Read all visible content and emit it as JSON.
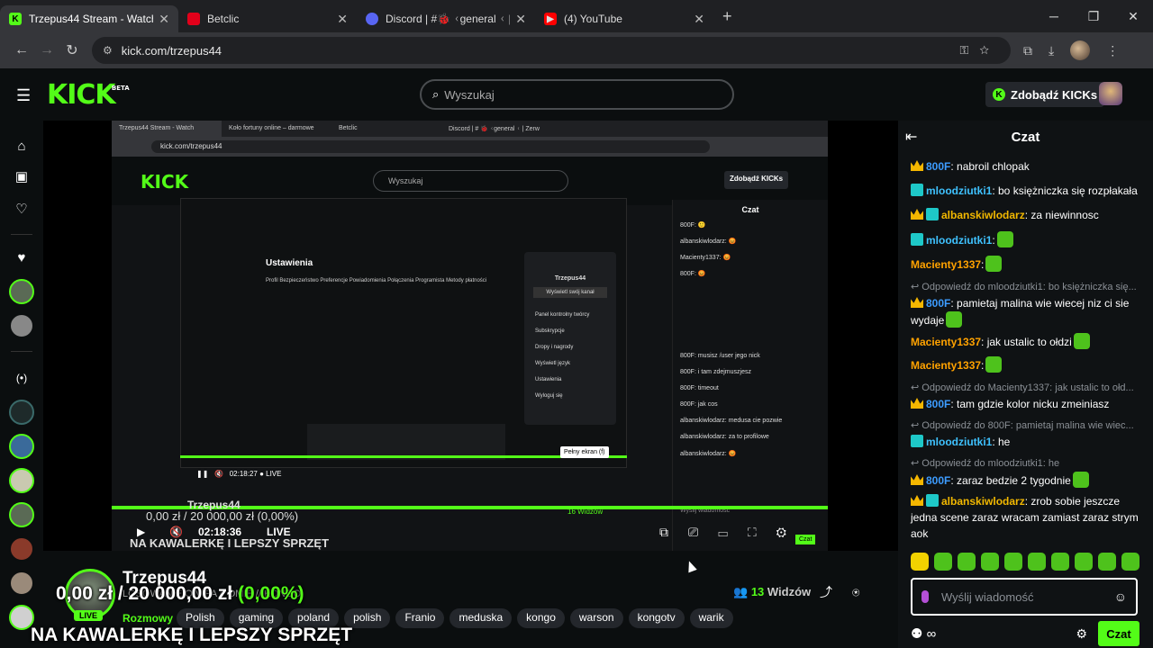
{
  "browser": {
    "tabs": [
      {
        "label": "Trzepus44 Stream - Watch Live",
        "favicon": "kick-icon",
        "color": "#53fc18",
        "active": true
      },
      {
        "label": "Betclic",
        "favicon": "betclic-icon",
        "color": "#e2001a",
        "active": false
      },
      {
        "label": "Discord | #🐞 ᚲgeneral ᚲ | Zerwa",
        "favicon": "discord-icon",
        "color": "#5865f2",
        "active": false
      },
      {
        "label": "(4) YouTube",
        "favicon": "youtube-icon",
        "color": "#ff0000",
        "active": false
      }
    ],
    "url": "kick.com/trzepus44"
  },
  "kick": {
    "logo": "KICK",
    "logo_sup": "BETA",
    "search_placeholder": "Wyszukaj",
    "kicks_button": "Zdobądź KICKs"
  },
  "stream": {
    "streamer": "Trzepus44",
    "subtitle": "LOSOWANIE O VIPA // OMIE // KONGO",
    "category": "Rozmowy",
    "tags": [
      "Polish",
      "gaming",
      "poland",
      "polish",
      "Franio",
      "meduska",
      "kongo",
      "warson",
      "kongotv",
      "warik"
    ],
    "viewers_count": "13",
    "viewers_label": "Widzów",
    "live_badge": "LIVE",
    "overlay_money": "0,00 zł",
    "overlay_goal": " / 20 000,00 zł",
    "overlay_pct": " (0,00%)",
    "overlay_title": "NA KAWALERKĘ I LEPSZY SPRZĘT"
  },
  "player": {
    "time": "02:18:36",
    "live": "LIVE",
    "nested": {
      "tabs": [
        "Trzepus44 Stream - Watch",
        "Koło fortuny online – darmowe",
        "Betclic",
        "Discord | # 🐞 ᚲgeneral ᚲ | Zerw"
      ],
      "url": "kick.com/trzepus44",
      "search": "Wyszukaj",
      "kicks": "Zdobądź KICKs",
      "chat_title": "Czat",
      "streamer": "Trzepus44",
      "money": "0,00 zł / 20 000,00 zł (0,00%)",
      "title_overlay": "NA KAWALERKĘ I LEPSZY SPRZĘT",
      "time": "02:18:36",
      "live": "LIVE",
      "inner_time": "02:18:27",
      "inner_live": "LIVE",
      "tooltip": "Pełny ekran (f)",
      "viewers": "16 Widzów",
      "chat_placeholder": "Wyślij wiadomość",
      "chat_send": "Czat",
      "chat_lines": [
        "800F: 🙂",
        "albanskiwlodarz: 😡",
        "Macienty1337: 😡",
        "800F: 😡",
        "800F: musisz /user jego nick",
        "800F: i tam zdejmuszjesz",
        "800F: timeout",
        "800F: jak cos",
        "albanskiwlodarz: medusa cie pozwie",
        "albanskiwlodarz: za to profilowe",
        "albanskiwlodarz: 😡"
      ],
      "menu_items": [
        "Trzepus44",
        "Wyświetl swój kanał",
        "Panel kontrolny twórcy",
        "Subskrypcje",
        "Dropy i nagrody",
        "Wyświetl język",
        "Ustawienia",
        "Wyloguj się"
      ],
      "settings_title": "Ustawienia",
      "settings_tabs": "Profil  Bezpieczeństwo  Preferencje  Powiadomienia  Połączenia  Programista  Metody płatności"
    }
  },
  "chat": {
    "title": "Czat",
    "input_placeholder": "Wyślij wiadomość",
    "send_label": "Czat",
    "messages": [
      {
        "reply": "",
        "user": "800F",
        "cls": "u-800f",
        "badges": "crown",
        "text": ": nabroil chlopak"
      },
      {
        "reply": "",
        "user": "mloodziutki1",
        "cls": "u-mloo",
        "badges": "sub",
        "text": ": bo księżniczka się rozpłakała"
      },
      {
        "reply": "",
        "user": "albanskiwlodarz",
        "cls": "u-alb",
        "badges": "crown sub",
        "text": ": za niewinnosc"
      },
      {
        "reply": "",
        "user": "mloodziutki1",
        "cls": "u-mloo",
        "badges": "sub",
        "text": ":"
      },
      {
        "reply": "",
        "user": "Macienty1337",
        "cls": "u-mac",
        "badges": "",
        "text": ":"
      },
      {
        "reply": "Odpowiedź do mloodziutki1: bo księżniczka się...",
        "user": "800F",
        "cls": "u-800f",
        "badges": "crown",
        "text": ": pamietaj malina wie wiecej niz ci sie wydaje"
      },
      {
        "reply": "",
        "user": "Macienty1337",
        "cls": "u-mac",
        "badges": "",
        "text": ": jak ustalic to ołdzi"
      },
      {
        "reply": "",
        "user": "Macienty1337",
        "cls": "u-mac",
        "badges": "",
        "text": ":"
      },
      {
        "reply": "Odpowiedź do Macienty1337: jak ustalic to ołd...",
        "user": "800F",
        "cls": "u-800f",
        "badges": "crown",
        "text": ": tam gdzie kolor nicku zmeiniasz"
      },
      {
        "reply": "Odpowiedź do 800F: pamietaj malina wie wiec...",
        "user": "mloodziutki1",
        "cls": "u-mloo",
        "badges": "sub",
        "text": ": he"
      },
      {
        "reply": "Odpowiedź do mloodziutki1: he",
        "user": "800F",
        "cls": "u-800f",
        "badges": "crown",
        "text": ": zaraz bedzie 2 tygodnie"
      },
      {
        "reply": "",
        "user": "albanskiwlodarz",
        "cls": "u-alb",
        "badges": "crown sub",
        "text": ": zrob sobie jeszcze jedna scene zaraz wracam zamiast zaraz strym aok"
      }
    ]
  },
  "colors": {
    "kick_green": "#53fc18",
    "background": "#0b0e0f"
  }
}
